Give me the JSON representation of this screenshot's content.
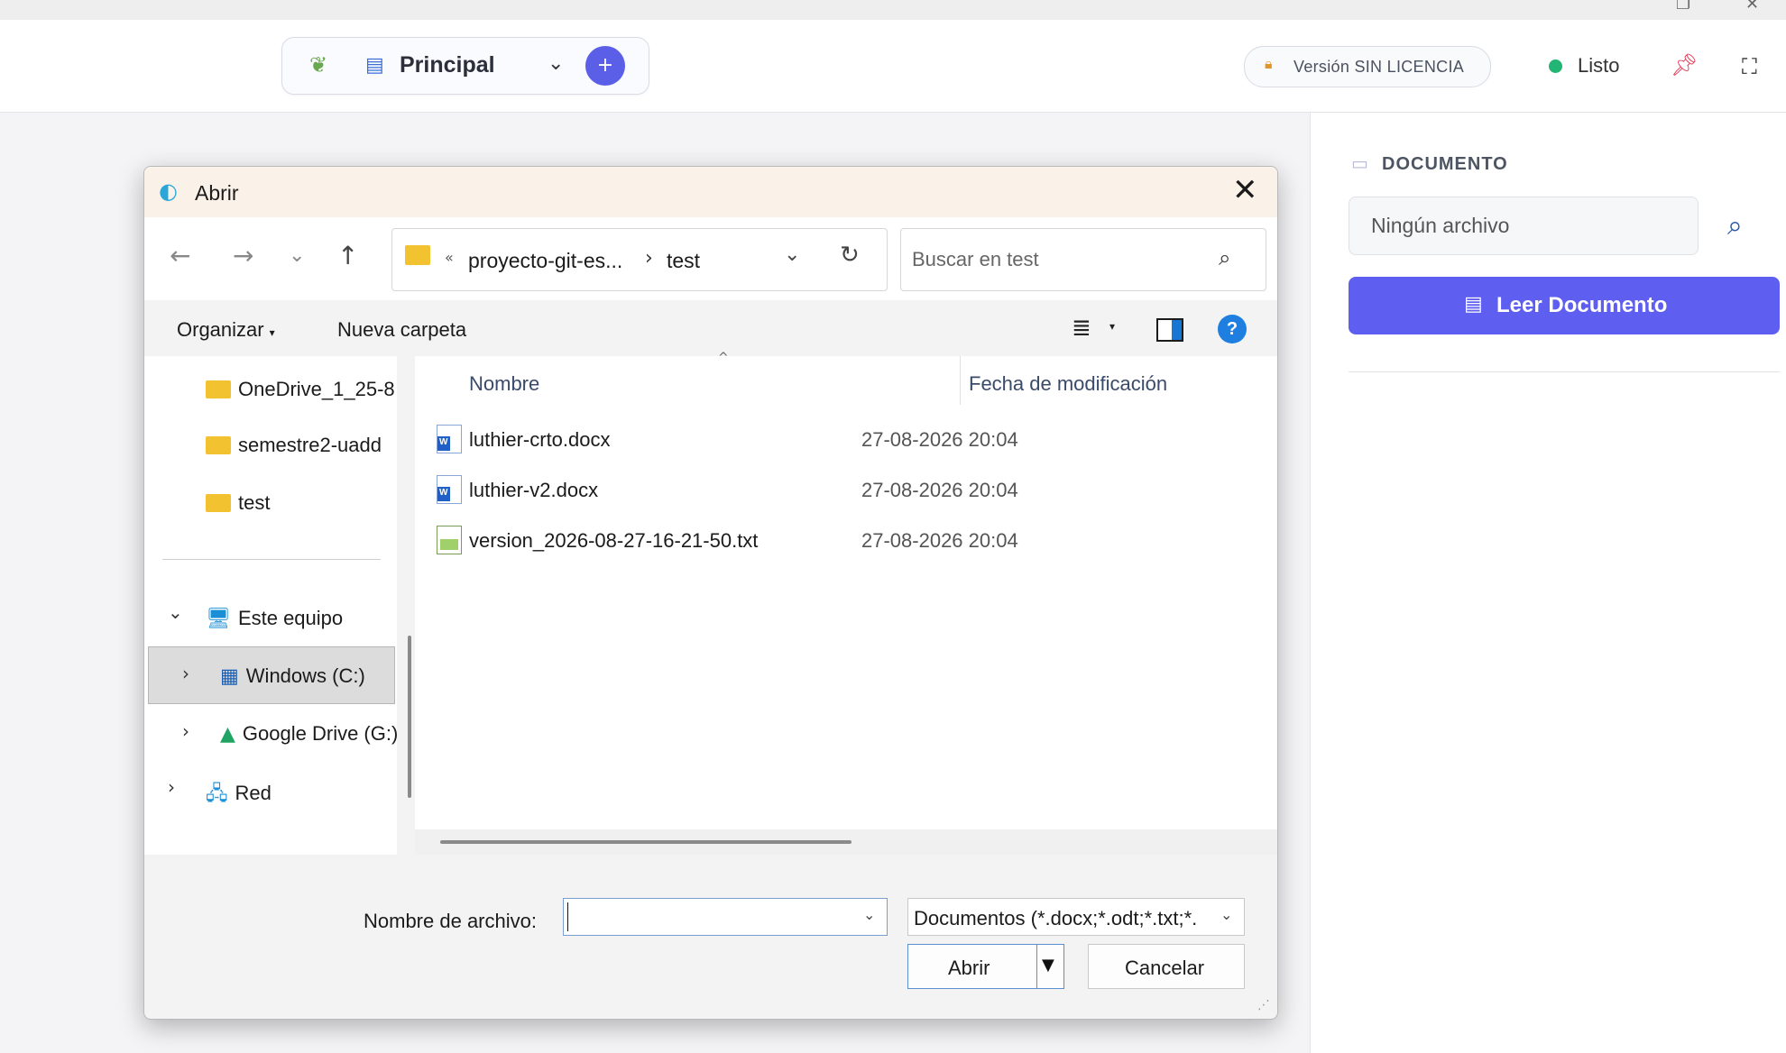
{
  "app": {
    "workspace_name": "Principal",
    "license_text": "Versión SIN LICENCIA",
    "status_text": "Listo",
    "colors": {
      "accent": "#5e5ef0",
      "status_ok": "#22b573",
      "pin": "#e23b55"
    }
  },
  "side_panel": {
    "section_title": "DOCUMENTO",
    "file_placeholder": "Ningún archivo",
    "read_button_label": "Leer Documento"
  },
  "dialog": {
    "title": "Abrir",
    "breadcrumb": {
      "parent": "proyecto-git-es...",
      "current": "test"
    },
    "search_placeholder": "Buscar en test",
    "commands": {
      "organize": "Organizar",
      "new_folder": "Nueva carpeta"
    },
    "tree": {
      "folders": [
        "OneDrive_1_25-8",
        "semestre2-uadd",
        "test"
      ],
      "this_pc": "Este equipo",
      "drives": [
        "Windows (C:)",
        "Google Drive (G:)"
      ],
      "network": "Red"
    },
    "columns": {
      "name": "Nombre",
      "modified": "Fecha de modificación"
    },
    "files": [
      {
        "name": "luthier-crto.docx",
        "modified": "27-08-2026 20:04",
        "icon": "word-doc-icon"
      },
      {
        "name": "luthier-v2.docx",
        "modified": "27-08-2026 20:04",
        "icon": "word-doc-icon"
      },
      {
        "name": "version_2026-08-27-16-21-50.txt",
        "modified": "27-08-2026 20:04",
        "icon": "text-file-icon"
      }
    ],
    "filename_label": "Nombre de archivo:",
    "filename_value": "",
    "file_type": "Documentos (*.docx;*.odt;*.txt;*.",
    "open_label": "Abrir",
    "cancel_label": "Cancelar"
  }
}
